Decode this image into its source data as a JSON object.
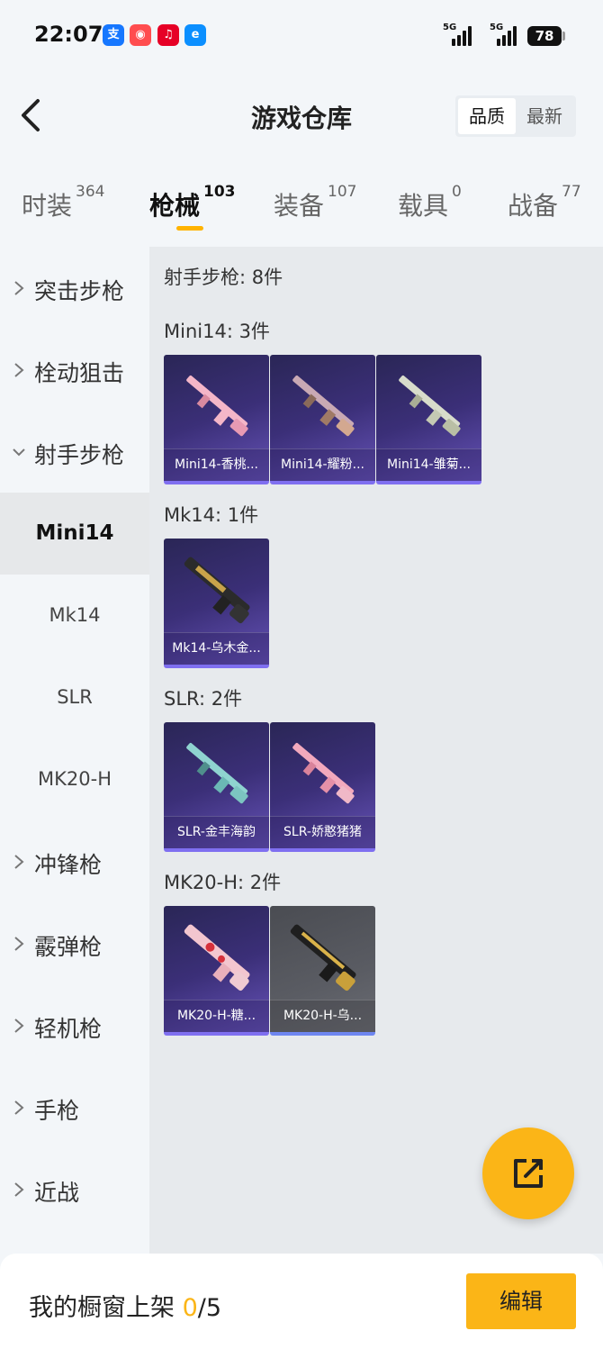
{
  "status": {
    "time": "22:07",
    "signal_1": "5G",
    "signal_2": "5G",
    "battery": "78"
  },
  "header": {
    "title": "游戏仓库",
    "sort_options": [
      "品质",
      "最新"
    ]
  },
  "tabs": [
    {
      "label": "时装",
      "count": "364"
    },
    {
      "label": "枪械",
      "count": "103"
    },
    {
      "label": "装备",
      "count": "107"
    },
    {
      "label": "载具",
      "count": "0"
    },
    {
      "label": "战备",
      "count": "77"
    }
  ],
  "sidebar": {
    "items": [
      {
        "label": "突击步枪"
      },
      {
        "label": "栓动狙击"
      },
      {
        "label": "射手步枪"
      },
      {
        "label": "冲锋枪"
      },
      {
        "label": "霰弹枪"
      },
      {
        "label": "轻机枪"
      },
      {
        "label": "手枪"
      },
      {
        "label": "近战"
      }
    ],
    "subitems": [
      {
        "label": "Mini14"
      },
      {
        "label": "Mk14"
      },
      {
        "label": "SLR"
      },
      {
        "label": "MK20-H"
      }
    ]
  },
  "content": {
    "category_title": "射手步枪: 8件",
    "groups": [
      {
        "title": "Mini14: 3件",
        "items": [
          "Mini14-香桃...",
          "Mini14-耀粉...",
          "Mini14-雏菊..."
        ]
      },
      {
        "title": "Mk14: 1件",
        "items": [
          "Mk14-乌木金..."
        ]
      },
      {
        "title": "SLR: 2件",
        "items": [
          "SLR-金丰海韵",
          "SLR-娇憨猪猪"
        ]
      },
      {
        "title": "MK20-H: 2件",
        "items": [
          "MK20-H-糖...",
          "MK20-H-乌..."
        ]
      }
    ]
  },
  "bottom": {
    "showcase_label": "我的橱窗上架 ",
    "showcase_current": "0",
    "showcase_total": "/5",
    "edit_label": "编辑"
  },
  "colors": {
    "accent": "#fbb517",
    "card_purple": "#3b2f78",
    "card_grey": "#55575d"
  }
}
